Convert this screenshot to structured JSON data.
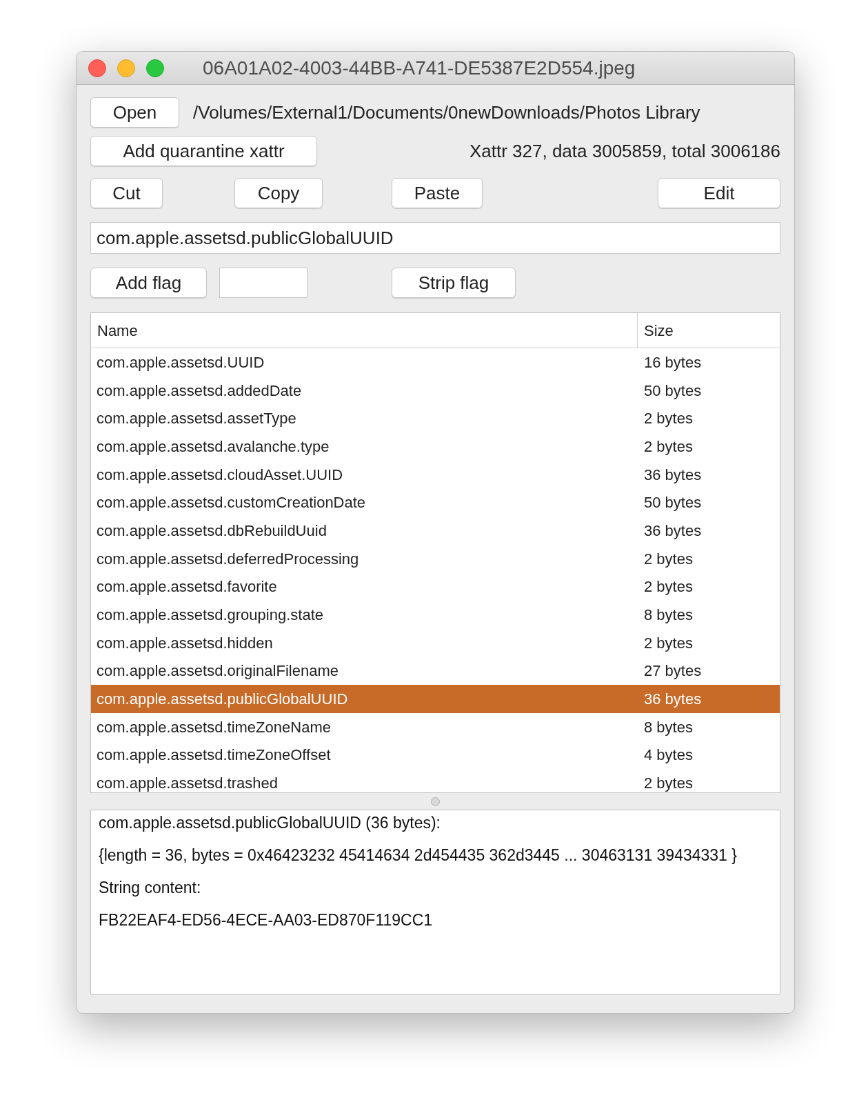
{
  "window": {
    "title": "06A01A02-4003-44BB-A741-DE5387E2D554.jpeg"
  },
  "open_button": "Open",
  "path": "/Volumes/External1/Documents/0newDownloads/Photos Library",
  "quarantine_button": "Add quarantine xattr",
  "summary": "Xattr 327, data 3005859, total 3006186",
  "edit_buttons": [
    "Cut",
    "Copy",
    "Paste",
    "Edit"
  ],
  "name_field": {
    "value": "com.apple.assetsd.publicGlobalUUID"
  },
  "add_flag_button": "Add flag",
  "strip_flag_button": "Strip flag",
  "table": {
    "columns": [
      "Name",
      "Size"
    ],
    "rows": [
      {
        "name": "com.apple.assetsd.UUID",
        "size": "16 bytes",
        "selected": false
      },
      {
        "name": "com.apple.assetsd.addedDate",
        "size": "50 bytes",
        "selected": false
      },
      {
        "name": "com.apple.assetsd.assetType",
        "size": "2 bytes",
        "selected": false
      },
      {
        "name": "com.apple.assetsd.avalanche.type",
        "size": "2 bytes",
        "selected": false
      },
      {
        "name": "com.apple.assetsd.cloudAsset.UUID",
        "size": "36 bytes",
        "selected": false
      },
      {
        "name": "com.apple.assetsd.customCreationDate",
        "size": "50 bytes",
        "selected": false
      },
      {
        "name": "com.apple.assetsd.dbRebuildUuid",
        "size": "36 bytes",
        "selected": false
      },
      {
        "name": "com.apple.assetsd.deferredProcessing",
        "size": "2 bytes",
        "selected": false
      },
      {
        "name": "com.apple.assetsd.favorite",
        "size": "2 bytes",
        "selected": false
      },
      {
        "name": "com.apple.assetsd.grouping.state",
        "size": "8 bytes",
        "selected": false
      },
      {
        "name": "com.apple.assetsd.hidden",
        "size": "2 bytes",
        "selected": false
      },
      {
        "name": "com.apple.assetsd.originalFilename",
        "size": "27 bytes",
        "selected": false
      },
      {
        "name": "com.apple.assetsd.publicGlobalUUID",
        "size": "36 bytes",
        "selected": true
      },
      {
        "name": "com.apple.assetsd.timeZoneName",
        "size": "8 bytes",
        "selected": false
      },
      {
        "name": "com.apple.assetsd.timeZoneOffset",
        "size": "4 bytes",
        "selected": false
      },
      {
        "name": "com.apple.assetsd.trashed",
        "size": "2 bytes",
        "selected": false
      }
    ]
  },
  "details": [
    "com.apple.assetsd.publicGlobalUUID (36 bytes):",
    "{length = 36, bytes = 0x46423232 45414634 2d454435 362d3445 ... 30463131 39434331 }",
    "String content:",
    "FB22EAF4-ED56-4ECE-AA03-ED870F119CC1"
  ]
}
